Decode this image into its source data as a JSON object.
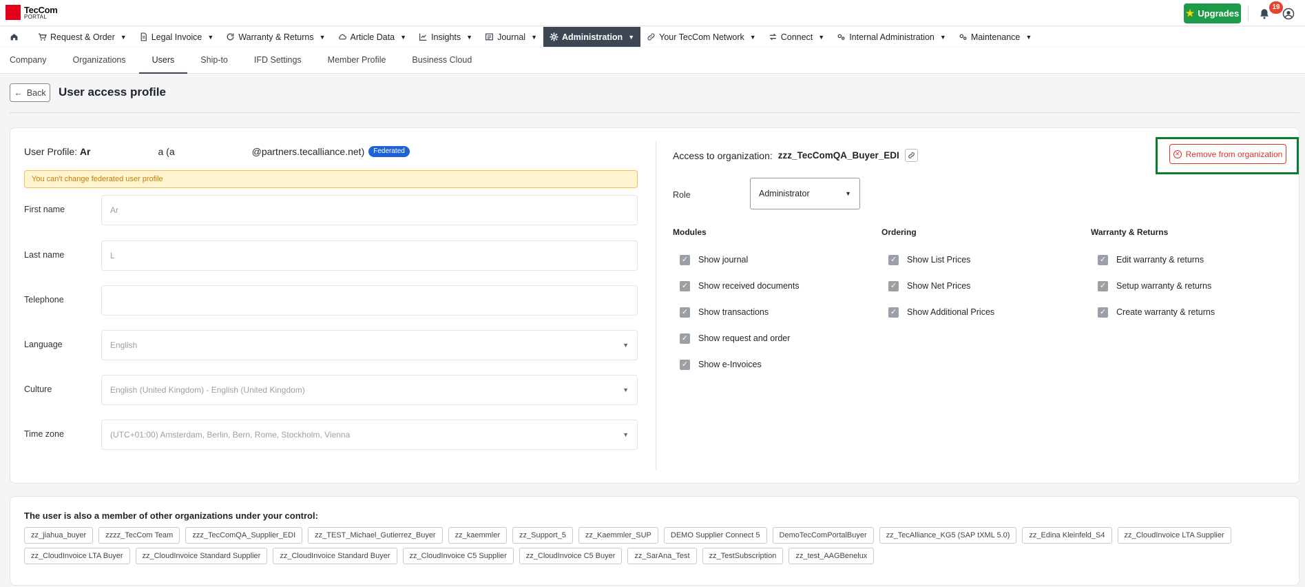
{
  "app": {
    "logo_line1": "TecCom",
    "logo_line2": "PORTAL",
    "upgrades_label": "Upgrades",
    "notification_count": "19",
    "colors": {
      "brand_red": "#e2001a",
      "upgrade_green": "#1d9b48",
      "nav_active": "#3d4653",
      "danger": "#d9342b",
      "federated_badge": "#1f62d6"
    }
  },
  "nav": {
    "items": [
      {
        "label": "Request & Order",
        "icon": "cart-icon"
      },
      {
        "label": "Legal Invoice",
        "icon": "document-icon"
      },
      {
        "label": "Warranty & Returns",
        "icon": "refresh-icon"
      },
      {
        "label": "Article Data",
        "icon": "cloud-icon"
      },
      {
        "label": "Insights",
        "icon": "chart-icon"
      },
      {
        "label": "Journal",
        "icon": "list-icon"
      },
      {
        "label": "Administration",
        "icon": "gear-icon",
        "active": true
      },
      {
        "label": "Your TecCom Network",
        "icon": "link-icon"
      },
      {
        "label": "Connect",
        "icon": "arrows-icon"
      },
      {
        "label": "Internal Administration",
        "icon": "gears-icon"
      },
      {
        "label": "Maintenance",
        "icon": "gears-icon"
      }
    ]
  },
  "subnav": {
    "tabs": [
      "Company",
      "Organizations",
      "Users",
      "Ship-to",
      "IFD Settings",
      "Member Profile",
      "Business Cloud"
    ],
    "active": "Users"
  },
  "page": {
    "back_label": "Back",
    "title": "User access profile"
  },
  "profile": {
    "prefix": "User Profile:",
    "name_part1": "Ar",
    "name_part2": "a (a",
    "email_domain": "@partners.tecalliance.net)",
    "federated_badge": "Federated",
    "warning": "You can't change federated user profile",
    "fields": [
      {
        "label": "First name",
        "value": "Ar"
      },
      {
        "label": "Last name",
        "value": "L"
      },
      {
        "label": "Telephone",
        "value": ""
      },
      {
        "label": "Language",
        "value": "English"
      },
      {
        "label": "Culture",
        "value": "English (United Kingdom) - English (United Kingdom)"
      },
      {
        "label": "Time zone",
        "value": "(UTC+01:00) Amsterdam, Berlin, Bern, Rome, Stockholm, Vienna"
      }
    ]
  },
  "access": {
    "prefix": "Access to organization:",
    "organization": "zzz_TecComQA_Buyer_EDI",
    "remove_label": "Remove from organization",
    "role_label": "Role",
    "role_value": "Administrator",
    "modules": {
      "title": "Modules",
      "items": [
        "Show journal",
        "Show received documents",
        "Show transactions",
        "Show request and order",
        "Show e-Invoices"
      ]
    },
    "ordering": {
      "title": "Ordering",
      "items": [
        "Show List Prices",
        "Show Net Prices",
        "Show Additional Prices"
      ]
    },
    "warranty": {
      "title": "Warranty & Returns",
      "items": [
        "Edit warranty & returns",
        "Setup warranty & returns",
        "Create warranty & returns"
      ]
    }
  },
  "other_orgs": {
    "title": "The user is also a member of other organizations under your control:",
    "items": [
      "zz_jiahua_buyer",
      "zzzz_TecCom Team",
      "zzz_TecComQA_Supplier_EDI",
      "zz_TEST_Michael_Gutierrez_Buyer",
      "zz_kaemmler",
      "zz_Support_5",
      "zz_Kaemmler_SUP",
      "DEMO Supplier Connect 5",
      "DemoTecComPortalBuyer",
      "zz_TecAlliance_KG5 (SAP tXML 5.0)",
      "zz_Edina Kleinfeld_S4",
      "zz_CloudInvoice LTA Supplier",
      "zz_CloudInvoice LTA Buyer",
      "zz_CloudInvoice Standard Supplier",
      "zz_CloudInvoice Standard Buyer",
      "zz_CloudInvoice C5 Supplier",
      "zz_CloudInvoice C5 Buyer",
      "zz_SarAna_Test",
      "zz_TestSubscription",
      "zz_test_AAGBenelux"
    ]
  }
}
